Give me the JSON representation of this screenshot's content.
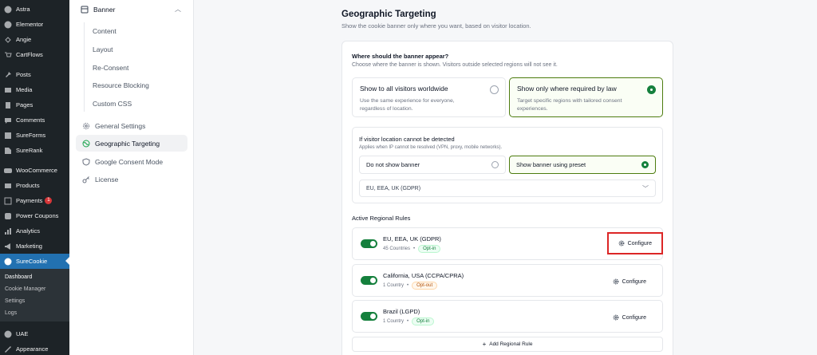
{
  "wp_menu": {
    "items_top": [
      {
        "label": "Astra",
        "icon": "astra-icon"
      },
      {
        "label": "Elementor",
        "icon": "elementor-icon"
      },
      {
        "label": "Angie",
        "icon": "angie-icon"
      },
      {
        "label": "CartFlows",
        "icon": "cartflows-icon"
      }
    ],
    "items_mid": [
      {
        "label": "Posts",
        "icon": "pin-icon"
      },
      {
        "label": "Media",
        "icon": "media-icon"
      },
      {
        "label": "Pages",
        "icon": "pages-icon"
      },
      {
        "label": "Comments",
        "icon": "comments-icon"
      },
      {
        "label": "SureForms",
        "icon": "sureforms-icon"
      },
      {
        "label": "SureRank",
        "icon": "surerank-icon"
      }
    ],
    "items_woo": [
      {
        "label": "WooCommerce",
        "icon": "woocommerce-icon"
      },
      {
        "label": "Products",
        "icon": "products-icon"
      },
      {
        "label": "Payments",
        "icon": "payments-icon",
        "badge": "1"
      },
      {
        "label": "Power Coupons",
        "icon": "coupons-icon"
      },
      {
        "label": "Analytics",
        "icon": "analytics-icon"
      },
      {
        "label": "Marketing",
        "icon": "marketing-icon"
      }
    ],
    "active": {
      "label": "SureCookie",
      "icon": "surecookie-icon"
    },
    "submenu": [
      "Dashboard",
      "Cookie Manager",
      "Settings",
      "Logs"
    ],
    "items_bottom": [
      {
        "label": "UAE",
        "icon": "uae-icon"
      },
      {
        "label": "Appearance",
        "icon": "appearance-icon"
      }
    ]
  },
  "subnav": {
    "banner": "Banner",
    "banner_children": [
      "Content",
      "Layout",
      "Re-Consent",
      "Resource Blocking",
      "Custom CSS"
    ],
    "general": "General Settings",
    "geo": "Geographic Targeting",
    "gcm": "Google Consent Mode",
    "license": "License"
  },
  "page": {
    "title": "Geographic Targeting",
    "subtitle": "Show the cookie banner only where you want, based on visitor location."
  },
  "where": {
    "title": "Where should the banner appear?",
    "subtitle": "Choose where the banner is shown. Visitors outside selected regions will not see it.",
    "option_all_title": "Show to all visitors worldwide",
    "option_all_desc": "Use the same experience for everyone, regardless of location.",
    "option_law_title": "Show only where required by law",
    "option_law_desc": "Target specific regions with tailored consent experiences."
  },
  "fallback": {
    "title": "If visitor location cannot be detected",
    "subtitle": "Applies when IP cannot be resolved (VPN, proxy, mobile networks).",
    "option_none": "Do not show banner",
    "option_preset": "Show banner using preset",
    "preset_value": "EU, EEA, UK (GDPR)"
  },
  "rules": {
    "title": "Active Regional Rules",
    "configure_label": "Configure",
    "add_label": "Add Regional Rule",
    "list": [
      {
        "name": "EU, EEA, UK (GDPR)",
        "count": "45 Countries",
        "mode": "Opt-in",
        "kind": "in",
        "enabled": true
      },
      {
        "name": "California, USA (CCPA/CPRA)",
        "count": "1 Country",
        "mode": "Opt-out",
        "kind": "out",
        "enabled": true
      },
      {
        "name": "Brazil (LGPD)",
        "count": "1 Country",
        "mode": "Opt-in",
        "kind": "in",
        "enabled": true
      }
    ]
  },
  "colors": {
    "wp_sidebar": "#1d2327",
    "wp_active": "#2271b1",
    "accent_green": "#15803d",
    "highlight_red": "#dc2626"
  }
}
